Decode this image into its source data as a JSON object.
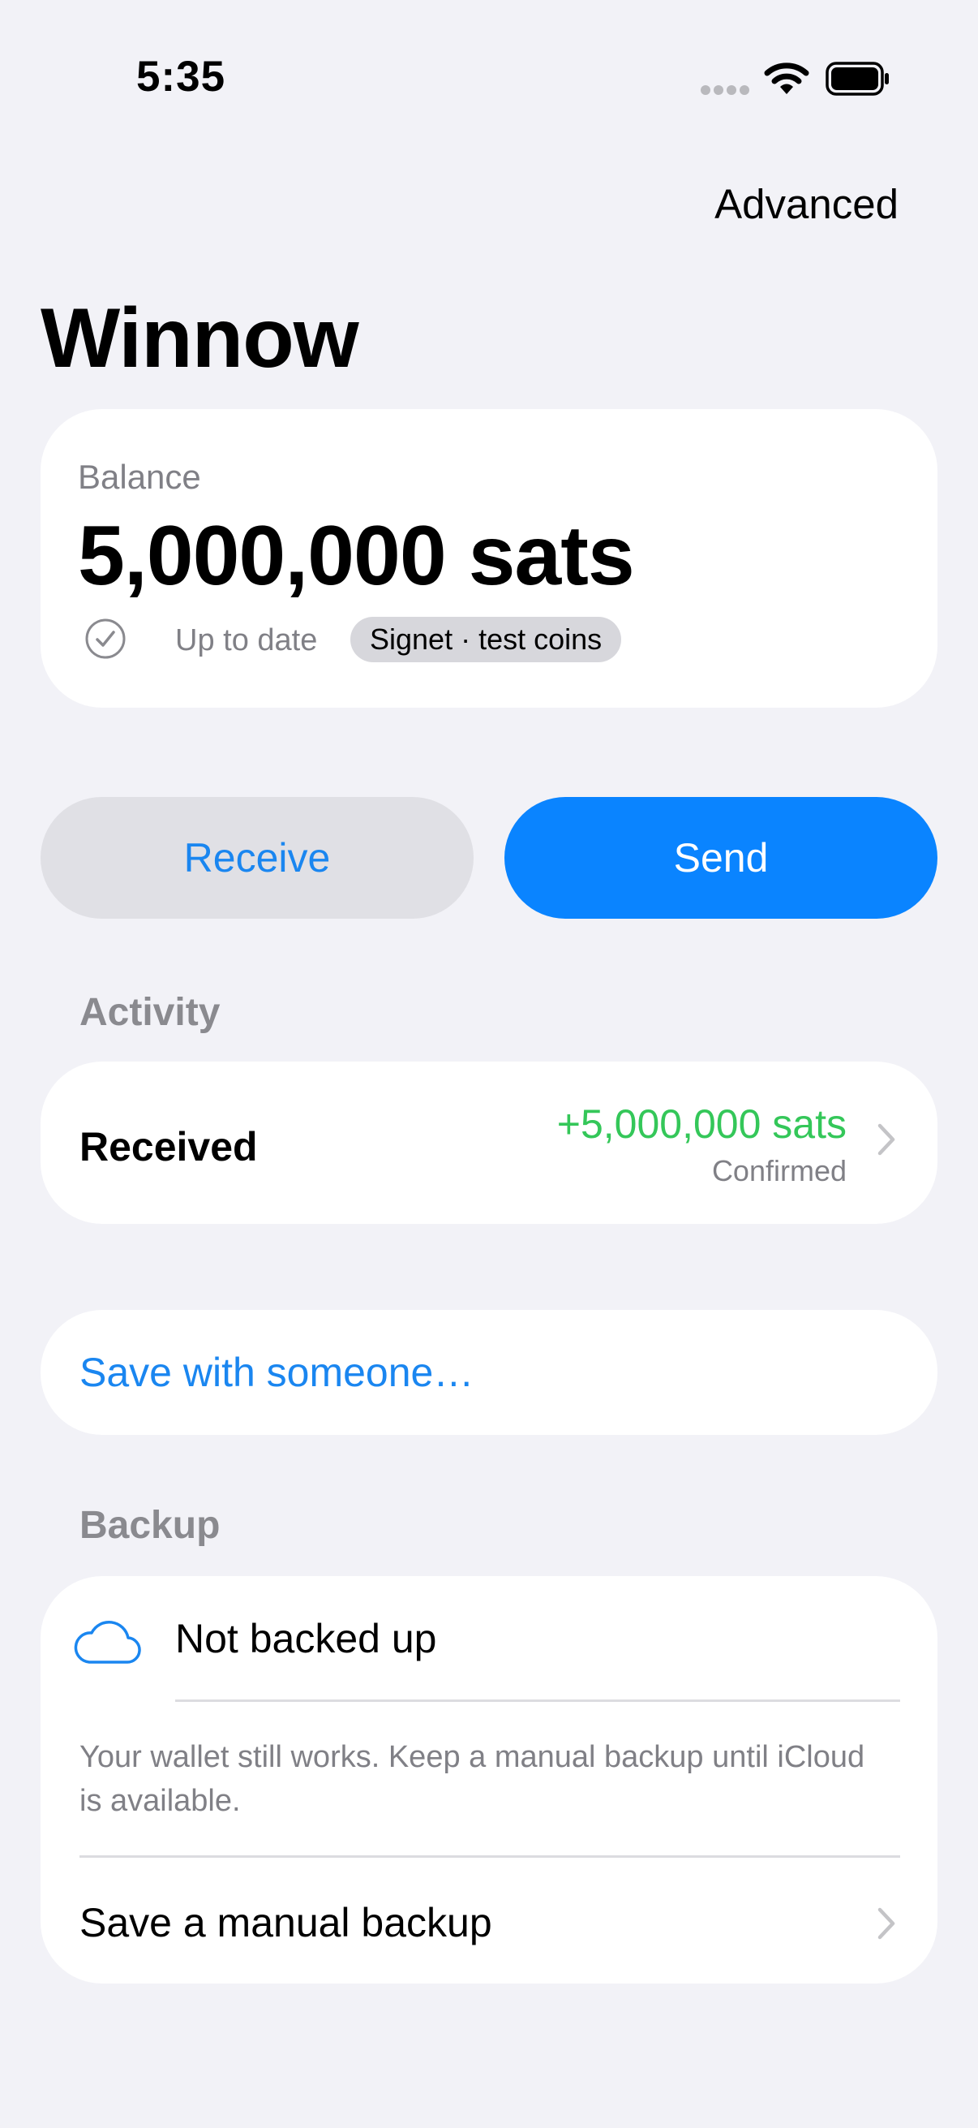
{
  "status_bar": {
    "time": "5:35",
    "icons": [
      "cellular-signal-icon",
      "wifi-icon",
      "battery-icon"
    ]
  },
  "nav": {
    "advanced_label": "Advanced"
  },
  "page_title": "Winnow",
  "balance": {
    "label": "Balance",
    "value": "5,000,000 sats",
    "sync_status": "Up to date",
    "network_badge": "Signet · test coins"
  },
  "actions": {
    "receive_label": "Receive",
    "send_label": "Send"
  },
  "activity": {
    "header": "Activity",
    "items": [
      {
        "label": "Received",
        "amount": "+5,000,000 sats",
        "status": "Confirmed"
      }
    ]
  },
  "save_with_someone": "Save with someone…",
  "backup": {
    "header": "Backup",
    "status": "Not backed up",
    "note": "Your wallet still works. Keep a manual backup until iCloud is available.",
    "manual_backup_label": "Save a manual backup"
  },
  "colors": {
    "background": "#f2f2f7",
    "accent": "#0a84ff",
    "link": "#1a86f0",
    "positive": "#34c759",
    "secondary_text": "#808086"
  }
}
